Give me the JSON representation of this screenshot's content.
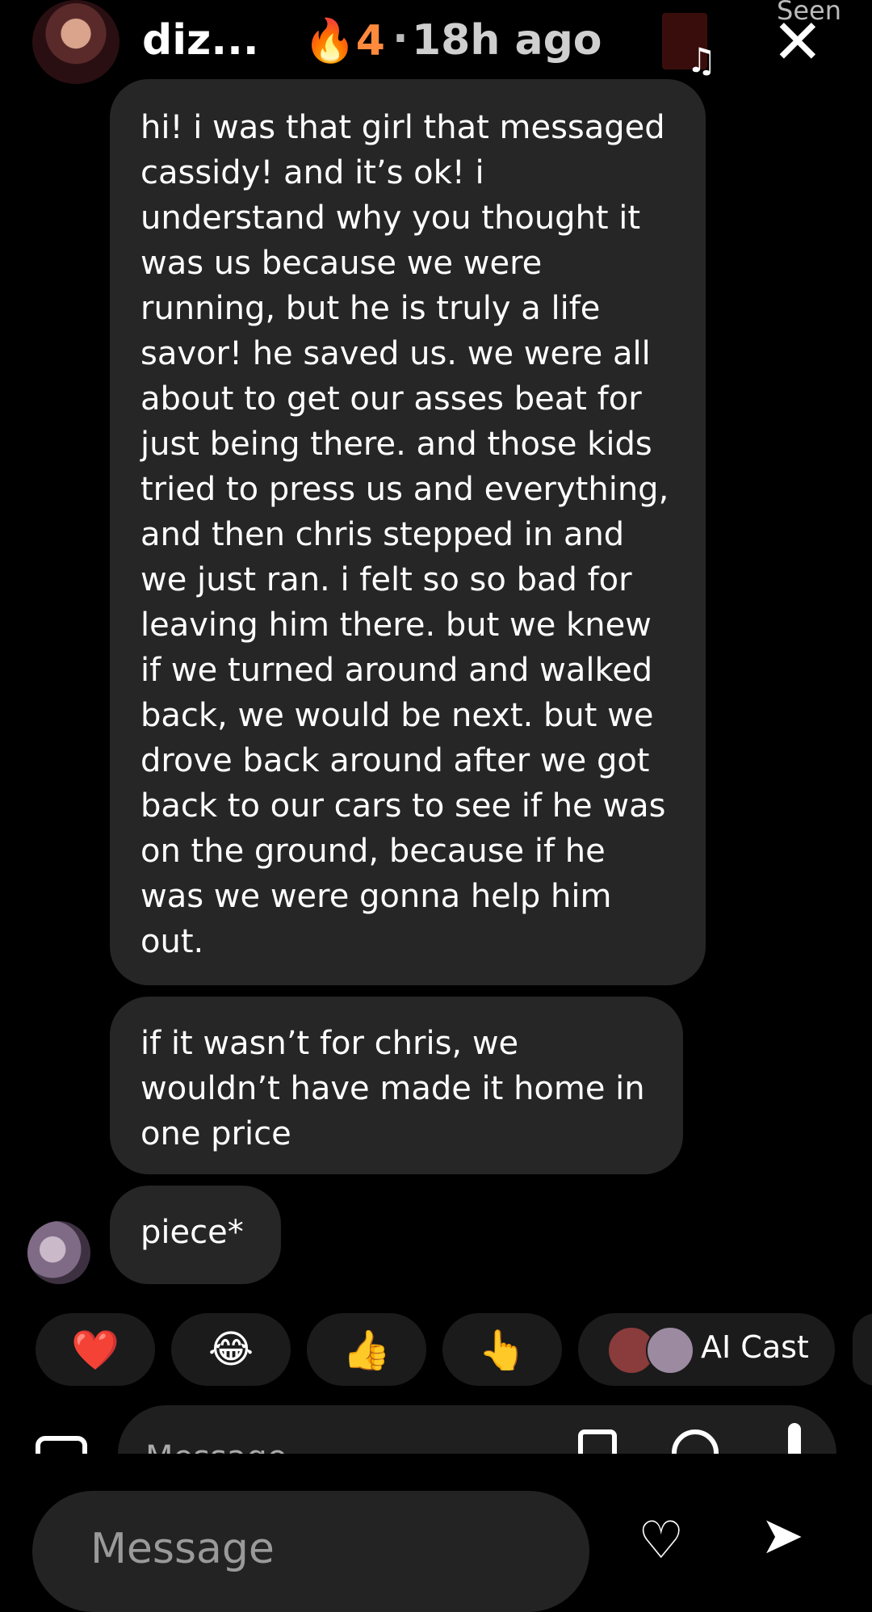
{
  "header": {
    "username": "diz...",
    "streak_icon": "🔥",
    "streak_count": "4",
    "separator": "·",
    "time_ago": "18h ago",
    "music_icon": "♫",
    "seen_label": "Seen",
    "close_icon": "✕"
  },
  "messages": [
    {
      "text": "hi! i was that girl that messaged cassidy! and it’s ok! i understand why you thought it was us because we were running, but he is truly a life savor! he saved us. we were all about to get our asses beat for just being there. and those kids tried to press us and everything, and then chris stepped in and we just ran. i felt so so bad for leaving him there. but we knew if we turned around and walked back, we would be next. but we drove back around after we got back to our cars to see if he was on the ground, because if he was we were gonna help him out."
    },
    {
      "text": "if it wasn’t for chris, we wouldn’t have made it home in one price"
    },
    {
      "text": "piece*"
    }
  ],
  "reactions": {
    "heart": "❤️",
    "laugh": "😂",
    "thumbs_up": "👍",
    "point": "👆",
    "ai_cast_label": "AI Cast"
  },
  "composer_inner": {
    "placeholder": "Message"
  },
  "composer_bottom": {
    "placeholder": "Message",
    "heart_icon": "♡",
    "share_icon": "➤"
  }
}
